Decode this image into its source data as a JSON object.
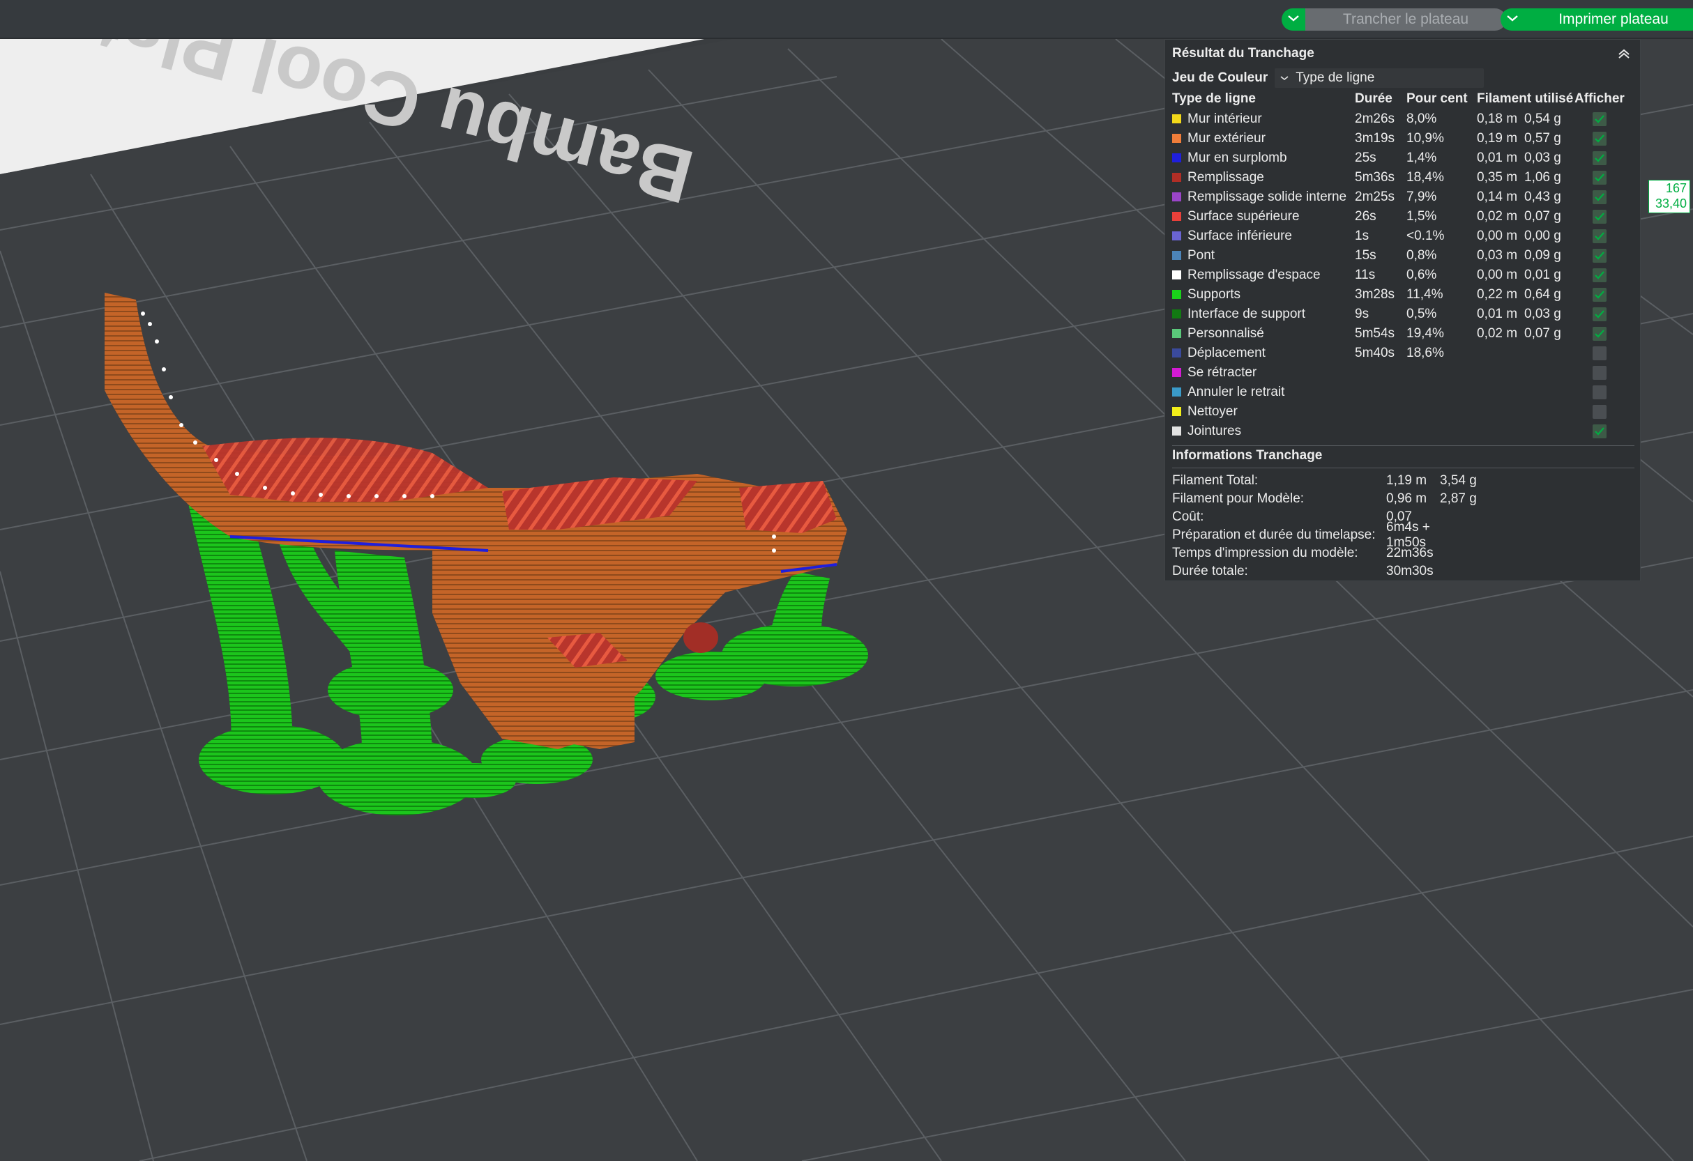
{
  "toolbar": {
    "slice_button": "Trancher le plateau",
    "print_button": "Imprimer plateau"
  },
  "plate": {
    "label": "Bambu Cool Plate > SuperTack"
  },
  "colors": {
    "accent": "#00ae42",
    "support": "#1bd21b",
    "outer_wall": "#c8642a"
  },
  "panel": {
    "title": "Résultat du Tranchage",
    "color_scheme_label": "Jeu de Couleur",
    "color_scheme_value": "Type de ligne",
    "columns": [
      "Type de ligne",
      "Durée",
      "Pour cent",
      "Filament utilisé",
      "Afficher"
    ],
    "rows": [
      {
        "name": "Mur intérieur",
        "color": "#f2d81a",
        "time": "2m26s",
        "pct": "8,0%",
        "len": "0,18 m",
        "wt": "0,54 g",
        "show": true
      },
      {
        "name": "Mur extérieur",
        "color": "#ef7d3a",
        "time": "3m19s",
        "pct": "10,9%",
        "len": "0,19 m",
        "wt": "0,57 g",
        "show": true
      },
      {
        "name": "Mur en surplomb",
        "color": "#1f1fdc",
        "time": "25s",
        "pct": "1,4%",
        "len": "0,01 m",
        "wt": "0,03 g",
        "show": true
      },
      {
        "name": "Remplissage",
        "color": "#b02e26",
        "time": "5m36s",
        "pct": "18,4%",
        "len": "0,35 m",
        "wt": "1,06 g",
        "show": true
      },
      {
        "name": "Remplissage solide interne",
        "color": "#9a45c8",
        "time": "2m25s",
        "pct": "7,9%",
        "len": "0,14 m",
        "wt": "0,43 g",
        "show": true
      },
      {
        "name": "Surface supérieure",
        "color": "#e8403a",
        "time": "26s",
        "pct": "1,5%",
        "len": "0,02 m",
        "wt": "0,07 g",
        "show": true
      },
      {
        "name": "Surface inférieure",
        "color": "#6a64d2",
        "time": "1s",
        "pct": "<0.1%",
        "len": "0,00 m",
        "wt": "0,00 g",
        "show": true
      },
      {
        "name": "Pont",
        "color": "#4c84b8",
        "time": "15s",
        "pct": "0,8%",
        "len": "0,03 m",
        "wt": "0,09 g",
        "show": true
      },
      {
        "name": "Remplissage d'espace",
        "color": "#ffffff",
        "time": "11s",
        "pct": "0,6%",
        "len": "0,00 m",
        "wt": "0,01 g",
        "show": true
      },
      {
        "name": "Supports",
        "color": "#1ad21a",
        "time": "3m28s",
        "pct": "11,4%",
        "len": "0,22 m",
        "wt": "0,64 g",
        "show": true
      },
      {
        "name": "Interface de support",
        "color": "#127a12",
        "time": "9s",
        "pct": "0,5%",
        "len": "0,01 m",
        "wt": "0,03 g",
        "show": true
      },
      {
        "name": "Personnalisé",
        "color": "#5ac87a",
        "time": "5m54s",
        "pct": "19,4%",
        "len": "0,02 m",
        "wt": "0,07 g",
        "show": true
      },
      {
        "name": "Déplacement",
        "color": "#3a4a9c",
        "time": "5m40s",
        "pct": "18,6%",
        "len": "",
        "wt": "",
        "show": false
      },
      {
        "name": "Se rétracter",
        "color": "#d41ad4",
        "time": "",
        "pct": "",
        "len": "",
        "wt": "",
        "show": false
      },
      {
        "name": "Annuler le retrait",
        "color": "#3a9ac8",
        "time": "",
        "pct": "",
        "len": "",
        "wt": "",
        "show": false
      },
      {
        "name": "Nettoyer",
        "color": "#f2ee1a",
        "time": "",
        "pct": "",
        "len": "",
        "wt": "",
        "show": false
      },
      {
        "name": "Jointures",
        "color": "#e2e2e2",
        "time": "",
        "pct": "",
        "len": "",
        "wt": "",
        "show": true
      }
    ],
    "info_title": "Informations Tranchage",
    "info": [
      {
        "key": "Filament Total:",
        "v1": "1,19 m",
        "v2": "3,54 g"
      },
      {
        "key": "Filament pour Modèle:",
        "v1": "0,96 m",
        "v2": "2,87 g"
      },
      {
        "key": "Coût:",
        "v1": "0,07",
        "v2": ""
      },
      {
        "key": "Préparation et durée du timelapse:",
        "v1": "6m4s + 1m50s",
        "v2": ""
      },
      {
        "key": "Temps d'impression du modèle:",
        "v1": "22m36s",
        "v2": ""
      },
      {
        "key": "Durée totale:",
        "v1": "30m30s",
        "v2": ""
      }
    ]
  },
  "layer_readout": {
    "layer": "167",
    "height": "33,40"
  }
}
